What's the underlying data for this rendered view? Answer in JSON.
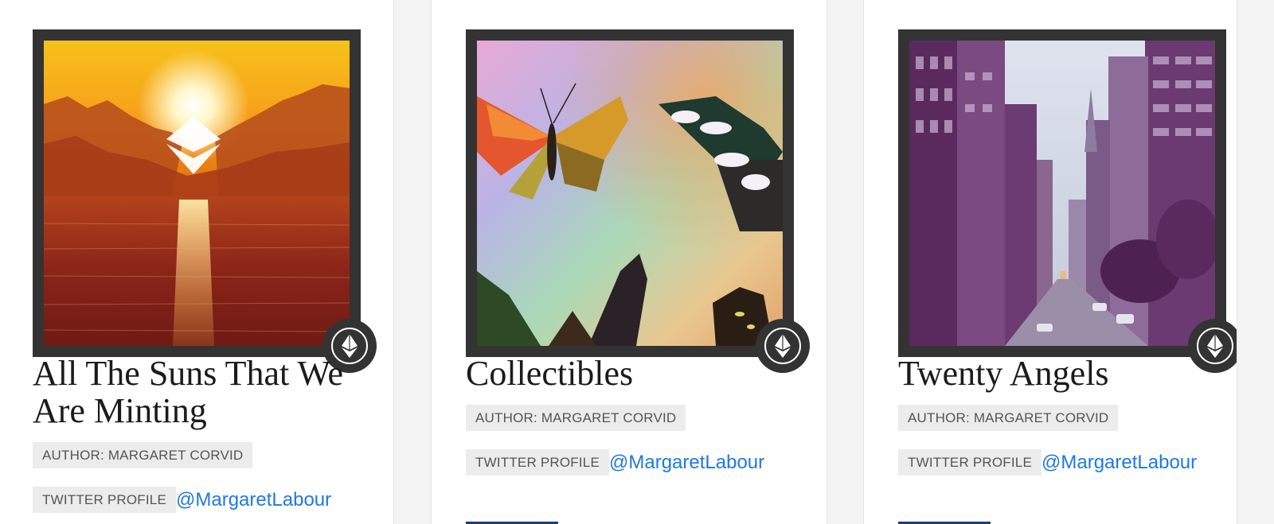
{
  "cards": [
    {
      "title": "All The Suns That We Are Minting",
      "author": "AUTHOR: MARGARET CORVID",
      "twitter_label": "TWITTER PROFILE",
      "twitter_handle": "@MargaretLabour",
      "image_subject": "sunset over water with ethereum logo",
      "badge_icon": "ethereum-icon"
    },
    {
      "title": "Collectibles",
      "author": "AUTHOR: MARGARET CORVID",
      "twitter_label": "TWITTER PROFILE",
      "twitter_handle": "@MargaretLabour",
      "image_subject": "butterflies on rainbow noise background",
      "badge_icon": "ethereum-icon"
    },
    {
      "title": "Twenty Angels",
      "author": "AUTHOR: MARGARET CORVID",
      "twitter_label": "TWITTER PROFILE",
      "twitter_handle": "@MargaretLabour",
      "image_subject": "stylized purple city street with skyscrapers",
      "badge_icon": "ethereum-icon"
    }
  ],
  "colors": {
    "frame": "#333333",
    "link": "#1e78e8",
    "tag_bg": "#ececec",
    "button": "#1d3e73"
  }
}
